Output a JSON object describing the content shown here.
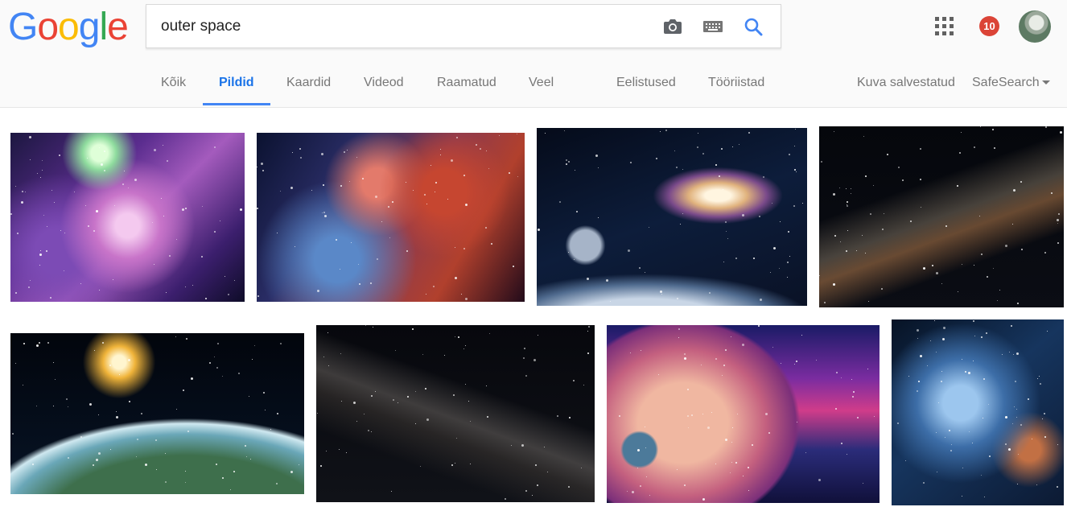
{
  "logo": {
    "letters": [
      "G",
      "o",
      "o",
      "g",
      "l",
      "e"
    ],
    "colors": [
      "#4285F4",
      "#EA4335",
      "#FBBC05",
      "#4285F4",
      "#34A853",
      "#EA4335"
    ]
  },
  "search": {
    "query": "outer space",
    "placeholder": ""
  },
  "header_icons": {
    "camera": "camera-icon",
    "keyboard": "keyboard-icon",
    "search": "search-icon",
    "apps": "apps-grid-icon"
  },
  "notifications": {
    "count": "10",
    "color": "#db4437"
  },
  "tabs": [
    {
      "label": "Kõik",
      "active": false
    },
    {
      "label": "Pildid",
      "active": true
    },
    {
      "label": "Kaardid",
      "active": false
    },
    {
      "label": "Videod",
      "active": false
    },
    {
      "label": "Raamatud",
      "active": false
    },
    {
      "label": "Veel",
      "active": false
    },
    {
      "label": "Eelistused",
      "active": false
    },
    {
      "label": "Tööriistad",
      "active": false
    }
  ],
  "right_tabs": {
    "saved": "Kuva salvestatud",
    "safesearch": "SafeSearch"
  },
  "accent": "#4285f4",
  "results": [
    {
      "name": "purple-nebula",
      "gradient": "radial-gradient(circle at 38% 12%, #dfffd8 0 4%, #8fdc9e 8%, transparent 18%), radial-gradient(circle at 50% 55%, #f4c9ef 0 8%, #c874c9 22%, transparent 45%), radial-gradient(circle at 20% 70%, #7c4bb5 0 10%, transparent 35%), linear-gradient(135deg, #1c1740 0%, #5b2d8f 35%, #a45bbd 55%, #3c1f6e 80%, #0e0c28 100%)"
    },
    {
      "name": "red-nebula",
      "gradient": "radial-gradient(circle at 70% 35%, #c64630 0 10%, transparent 30%), radial-gradient(circle at 45% 30%, #e37a6b 0 8%, transparent 28%), radial-gradient(circle at 30% 75%, #5a88c8 0 10%, transparent 35%), linear-gradient(120deg, #0b1230 0%, #2a2d66 30%, #8d3a4e 55%, #b1402d 75%, #220b1a 100%)"
    },
    {
      "name": "spiral-galaxy-planets",
      "gradient": "radial-gradient(ellipse 24% 16% at 67% 38%, #fff5e0 0 20%, #e0b27d 45%, #7a4a8a 75%, transparent 100%), radial-gradient(ellipse 90% 40% at 40% 110%, #c9d6e6 0 35%, #4f6a8e 55%, transparent 70%), radial-gradient(circle at 18% 66%, #a6b4c8 0 6%, transparent 8%), linear-gradient(160deg, #050b1a 0%, #0d1d3b 50%, #0a1226 100%)"
    },
    {
      "name": "milky-way-dark",
      "gradient": "linear-gradient(160deg, transparent 35%, rgba(190,170,140,0.35) 50%, rgba(220,150,90,0.45) 58%, transparent 72%), linear-gradient(180deg, #05070c 0%, #0b0d14 100%)"
    },
    {
      "name": "earth-horizon",
      "gradient": "radial-gradient(circle at 37% 18%, #fff5cf 0 3%, #f0b43a 7%, transparent 16%), radial-gradient(ellipse 120% 110% at 60% 120%, #3e6f4c 0 40%, #6aa7b8 52%, #cfe8f0 58%, transparent 61%), linear-gradient(180deg, #02050c 0%, #071426 100%)"
    },
    {
      "name": "milky-way-stars",
      "gradient": "linear-gradient(200deg, transparent 38%, rgba(160,150,140,0.35) 52%, rgba(90,80,70,0.35) 60%, transparent 74%), linear-gradient(180deg, #07080d 0%, #101218 100%)"
    },
    {
      "name": "giant-planet-landscape",
      "gradient": "radial-gradient(circle at 12% 70%, #4c7a9a 0 6%, transparent 7%), radial-gradient(ellipse 55% 75% at 28% 55%, #f0b7a1 0 30%, #c4607f 55%, #7b2f7a 75%, transparent 78%), linear-gradient(180deg, #1a1b66 0%, #7a2ca0 30%, #d03c8a 48%, #2b2c7a 70%, #10103a 100%)"
    },
    {
      "name": "star-cluster-blue",
      "gradient": "radial-gradient(circle at 40% 45%, #9cc6ee 0 12%, #3d6ea8 30%, transparent 55%), radial-gradient(circle at 80% 70%, #c27044 0 6%, transparent 20%), linear-gradient(140deg, #071325 0%, #16355e 45%, #0c1a33 100%)"
    }
  ]
}
